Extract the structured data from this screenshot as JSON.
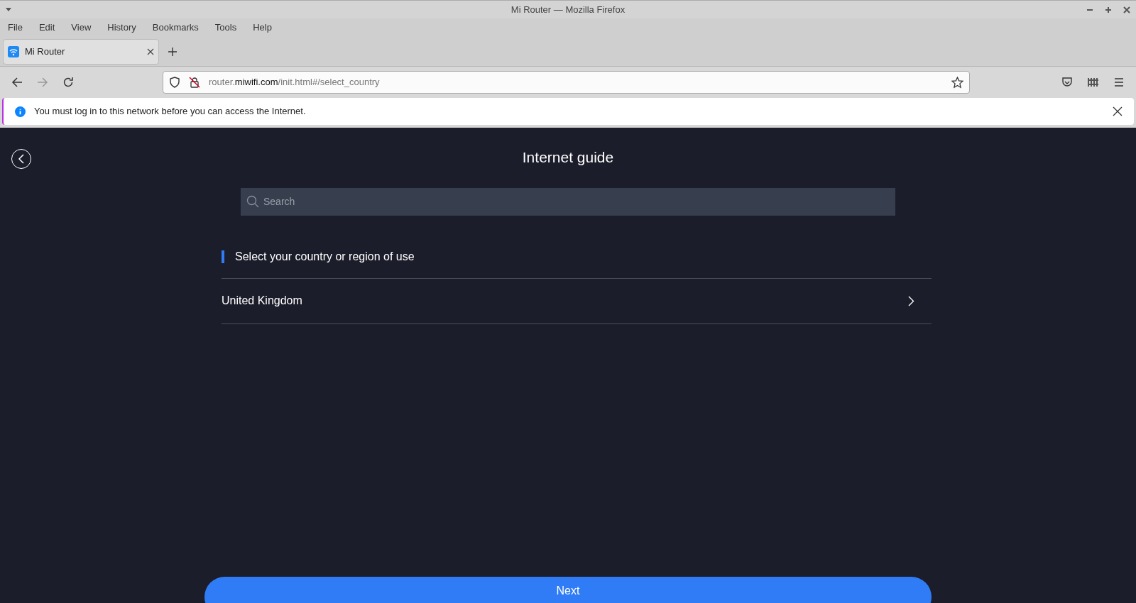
{
  "window": {
    "title": "Mi Router — Mozilla Firefox"
  },
  "menu": [
    "File",
    "Edit",
    "View",
    "History",
    "Bookmarks",
    "Tools",
    "Help"
  ],
  "tabs": [
    {
      "label": "Mi Router",
      "selected": true
    }
  ],
  "address_bar": {
    "url_prefix": "router.",
    "url_domain": "miwifi.com",
    "url_path": "/init.html#/select_country"
  },
  "notification": {
    "text": "You must log in to this network before you can access the Internet."
  },
  "page": {
    "title": "Internet guide",
    "search": {
      "placeholder": "Search"
    },
    "section_heading": "Select your country or region of use",
    "countries": [
      {
        "name": "United Kingdom"
      }
    ],
    "next_button": "Next"
  }
}
